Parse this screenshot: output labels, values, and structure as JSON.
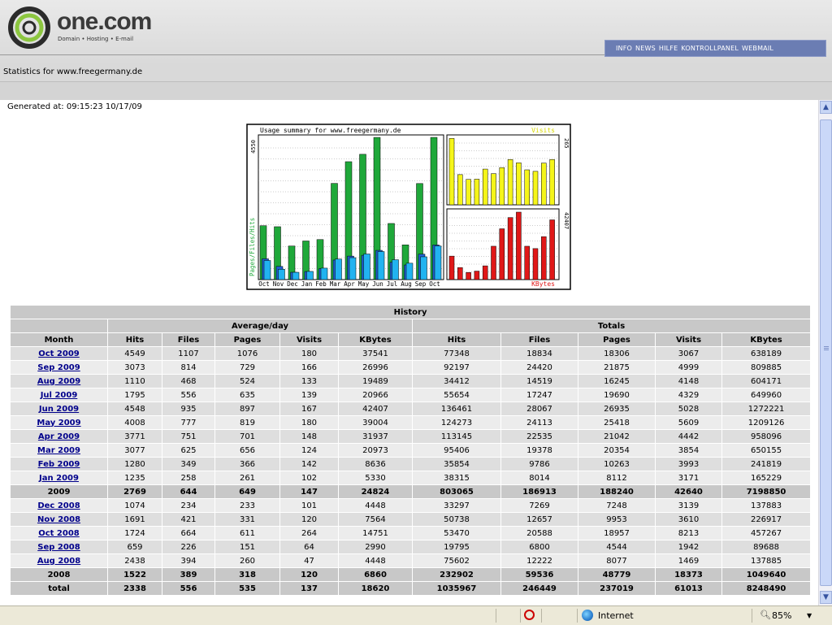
{
  "header": {
    "brand": "one.com",
    "tagline": "Domain • Hosting • E-mail",
    "nav": [
      "INFO",
      "NEWS",
      "HILFE",
      "KONTROLLPANEL",
      "WEBMAIL"
    ]
  },
  "stats_title": "Statistics for www.freegermany.de",
  "generated": "Generated at: 09:15:23 10/17/09",
  "graph": {
    "title": "Usage summary for www.freegermany.de",
    "left_max": "4550",
    "left_axis_label": "Pages/Files/Hits",
    "visits_label": "Visits",
    "visits_max": "265",
    "kbytes_label": "KBytes",
    "kbytes_max": "42407",
    "colors": {
      "hits": "#1fa83a",
      "files": "#1f5fd0",
      "pages": "#22b3f0",
      "visits": "#f5f51a",
      "kbytes": "#e01818"
    }
  },
  "chart_data": {
    "type": "bar",
    "categories": [
      "Oct",
      "Nov",
      "Dec",
      "Jan",
      "Feb",
      "Mar",
      "Apr",
      "May",
      "Jun",
      "Jul",
      "Aug",
      "Sep",
      "Oct"
    ],
    "series": [
      {
        "name": "Hits",
        "values": [
          1724,
          1691,
          1074,
          1235,
          1280,
          3077,
          3771,
          4008,
          4548,
          1795,
          1110,
          3073,
          4549
        ]
      },
      {
        "name": "Files",
        "values": [
          664,
          421,
          234,
          258,
          349,
          625,
          751,
          777,
          935,
          556,
          468,
          814,
          1107
        ]
      },
      {
        "name": "Pages",
        "values": [
          611,
          331,
          233,
          261,
          366,
          656,
          701,
          819,
          897,
          635,
          524,
          729,
          1076
        ]
      },
      {
        "name": "Visits",
        "values": [
          264,
          120,
          101,
          102,
          142,
          124,
          148,
          180,
          167,
          139,
          133,
          166,
          180
        ]
      },
      {
        "name": "KBytes",
        "values": [
          14751,
          7564,
          4448,
          5330,
          8636,
          20973,
          31937,
          39004,
          42407,
          20966,
          19489,
          26996,
          37541
        ]
      }
    ]
  },
  "history": {
    "title": "History",
    "group_avg": "Average/day",
    "group_totals": "Totals",
    "columns": [
      "Month",
      "Hits",
      "Files",
      "Pages",
      "Visits",
      "KBytes",
      "Hits",
      "Files",
      "Pages",
      "Visits",
      "KBytes"
    ],
    "rows": [
      {
        "month": "Oct 2009",
        "link": true,
        "cells": [
          "4549",
          "1107",
          "1076",
          "180",
          "37541",
          "77348",
          "18834",
          "18306",
          "3067",
          "638189"
        ]
      },
      {
        "month": "Sep 2009",
        "link": true,
        "cells": [
          "3073",
          "814",
          "729",
          "166",
          "26996",
          "92197",
          "24420",
          "21875",
          "4999",
          "809885"
        ]
      },
      {
        "month": "Aug 2009",
        "link": true,
        "cells": [
          "1110",
          "468",
          "524",
          "133",
          "19489",
          "34412",
          "14519",
          "16245",
          "4148",
          "604171"
        ]
      },
      {
        "month": "Jul 2009",
        "link": true,
        "cells": [
          "1795",
          "556",
          "635",
          "139",
          "20966",
          "55654",
          "17247",
          "19690",
          "4329",
          "649960"
        ]
      },
      {
        "month": "Jun 2009",
        "link": true,
        "cells": [
          "4548",
          "935",
          "897",
          "167",
          "42407",
          "136461",
          "28067",
          "26935",
          "5028",
          "1272221"
        ]
      },
      {
        "month": "May 2009",
        "link": true,
        "cells": [
          "4008",
          "777",
          "819",
          "180",
          "39004",
          "124273",
          "24113",
          "25418",
          "5609",
          "1209126"
        ]
      },
      {
        "month": "Apr 2009",
        "link": true,
        "cells": [
          "3771",
          "751",
          "701",
          "148",
          "31937",
          "113145",
          "22535",
          "21042",
          "4442",
          "958096"
        ]
      },
      {
        "month": "Mar 2009",
        "link": true,
        "cells": [
          "3077",
          "625",
          "656",
          "124",
          "20973",
          "95406",
          "19378",
          "20354",
          "3854",
          "650155"
        ]
      },
      {
        "month": "Feb 2009",
        "link": true,
        "cells": [
          "1280",
          "349",
          "366",
          "142",
          "8636",
          "35854",
          "9786",
          "10263",
          "3993",
          "241819"
        ]
      },
      {
        "month": "Jan 2009",
        "link": true,
        "cells": [
          "1235",
          "258",
          "261",
          "102",
          "5330",
          "38315",
          "8014",
          "8112",
          "3171",
          "165229"
        ]
      },
      {
        "month": "2009",
        "link": false,
        "kind": "year",
        "cells": [
          "2769",
          "644",
          "649",
          "147",
          "24824",
          "803065",
          "186913",
          "188240",
          "42640",
          "7198850"
        ]
      },
      {
        "month": "Dec 2008",
        "link": true,
        "cells": [
          "1074",
          "234",
          "233",
          "101",
          "4448",
          "33297",
          "7269",
          "7248",
          "3139",
          "137883"
        ]
      },
      {
        "month": "Nov 2008",
        "link": true,
        "cells": [
          "1691",
          "421",
          "331",
          "120",
          "7564",
          "50738",
          "12657",
          "9953",
          "3610",
          "226917"
        ]
      },
      {
        "month": "Oct 2008",
        "link": true,
        "cells": [
          "1724",
          "664",
          "611",
          "264",
          "14751",
          "53470",
          "20588",
          "18957",
          "8213",
          "457267"
        ]
      },
      {
        "month": "Sep 2008",
        "link": true,
        "cells": [
          "659",
          "226",
          "151",
          "64",
          "2990",
          "19795",
          "6800",
          "4544",
          "1942",
          "89688"
        ]
      },
      {
        "month": "Aug 2008",
        "link": true,
        "cells": [
          "2438",
          "394",
          "260",
          "47",
          "4448",
          "75602",
          "12222",
          "8077",
          "1469",
          "137885"
        ]
      },
      {
        "month": "2008",
        "link": false,
        "kind": "year",
        "cells": [
          "1522",
          "389",
          "318",
          "120",
          "6860",
          "232902",
          "59536",
          "48779",
          "18373",
          "1049640"
        ]
      },
      {
        "month": "total",
        "link": false,
        "kind": "total",
        "cells": [
          "2338",
          "556",
          "535",
          "137",
          "18620",
          "1035967",
          "246449",
          "237019",
          "61013",
          "8248490"
        ]
      }
    ]
  },
  "statusbar": {
    "zone": "Internet",
    "zoom": "85%"
  }
}
